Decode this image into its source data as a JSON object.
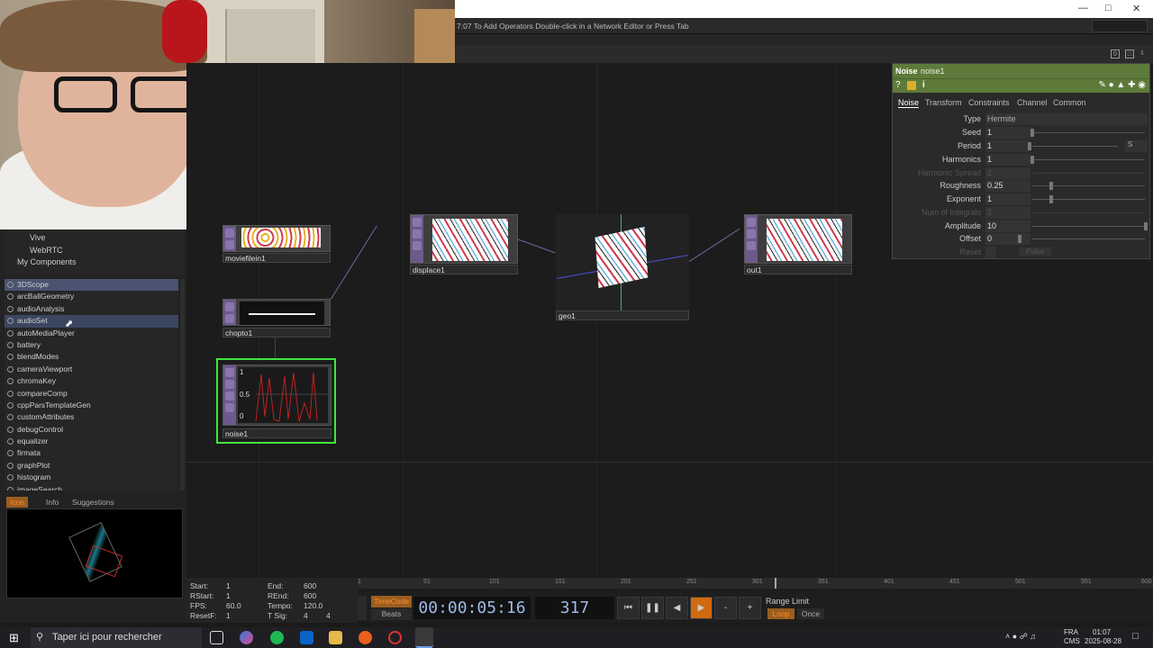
{
  "window": {
    "message": "7:07 To Add Operators Double-click in a Network Editor or Press Tab",
    "path_counter": "0"
  },
  "left_panel": {
    "top_items": [
      "Vive",
      "WebRTC",
      "My Components"
    ],
    "list": [
      "3DScope",
      "arcBallGeometry",
      "audioAnalysis",
      "audioSet",
      "autoMediaPlayer",
      "battery",
      "blendModes",
      "cameraViewport",
      "chromaKey",
      "compareComp",
      "cppParsTemplateGen",
      "customAttributes",
      "debugControl",
      "equalizer",
      "firmata",
      "graphPlot",
      "histogram",
      "imageSearch"
    ],
    "tabs": [
      "Icon",
      "Info",
      "Suggestions"
    ]
  },
  "nodes": {
    "moviefilein": "moviefilein1",
    "displace": "displace1",
    "geo": "geo1",
    "out": "out1",
    "chopto": "chopto1",
    "noise": "noise1"
  },
  "noise_graph": {
    "max": "1",
    "mid": "0.5",
    "min": "0"
  },
  "param_panel": {
    "type_label": "Noise",
    "op_name": "noise1",
    "tabs": [
      "Noise",
      "Transform",
      "Constraints",
      "Channel",
      "Common"
    ],
    "params": [
      {
        "name": "Type",
        "value": "Hermite"
      },
      {
        "name": "Seed",
        "value": "1"
      },
      {
        "name": "Period",
        "value": "1",
        "unit": "S"
      },
      {
        "name": "Harmonics",
        "value": "1"
      },
      {
        "name": "Harmonic Spread",
        "value": "2"
      },
      {
        "name": "Roughness",
        "value": "0.25"
      },
      {
        "name": "Exponent",
        "value": "1"
      },
      {
        "name": "Num of Integrals",
        "value": "2"
      },
      {
        "name": "Amplitude",
        "value": "10"
      },
      {
        "name": "Offset",
        "value": "0"
      }
    ],
    "reset_label": "Reset",
    "pulse_label": "Pulse"
  },
  "timeline": {
    "start": {
      "label": "Start:",
      "value": "1"
    },
    "end": {
      "label": "End:",
      "value": "600"
    },
    "rstart": {
      "label": "RStart:",
      "value": "1"
    },
    "rend": {
      "label": "REnd:",
      "value": "600"
    },
    "fps": {
      "label": "FPS:",
      "value": "60.0"
    },
    "tempo": {
      "label": "Tempo:",
      "value": "120.0"
    },
    "resetf": {
      "label": "ResetF:",
      "value": "1"
    },
    "tsig": {
      "label": "T Sig:",
      "value": "4",
      "value2": "4"
    },
    "ticks": [
      "1",
      "51",
      "101",
      "151",
      "201",
      "251",
      "301",
      "351",
      "401",
      "451",
      "501",
      "551",
      "600"
    ],
    "timecode_label": "TimeCode",
    "beats_label": "Beats",
    "timecode": "00:00:05:16",
    "frame": "317",
    "range_limit": "Range Limit",
    "loop": "Loop",
    "once": "Once"
  },
  "taskbar": {
    "search_placeholder": "Taper ici pour rechercher",
    "lang1": "FRA",
    "lang2": "CMS",
    "time": "01:07",
    "date": "2025-08-28"
  }
}
